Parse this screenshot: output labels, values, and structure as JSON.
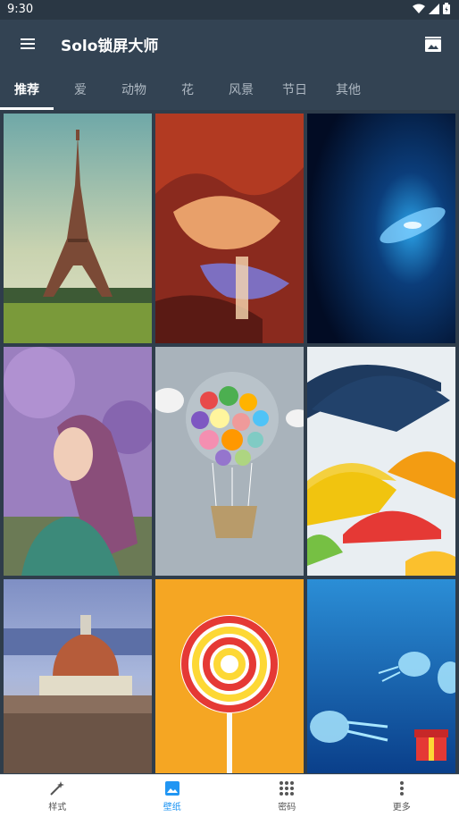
{
  "status": {
    "time": "9:30"
  },
  "app": {
    "title": "Solo锁屏大师"
  },
  "tabs": [
    {
      "label": "推荐",
      "active": true
    },
    {
      "label": "爱"
    },
    {
      "label": "动物"
    },
    {
      "label": "花"
    },
    {
      "label": "风景"
    },
    {
      "label": "节日"
    },
    {
      "label": "其他"
    }
  ],
  "wallpapers": [
    {
      "name": "eiffel-tower"
    },
    {
      "name": "antelope-canyon"
    },
    {
      "name": "blue-galaxy"
    },
    {
      "name": "girl-purple"
    },
    {
      "name": "button-balloon"
    },
    {
      "name": "umbrellas"
    },
    {
      "name": "florence-cathedral"
    },
    {
      "name": "lollipop"
    },
    {
      "name": "jellyfish"
    }
  ],
  "bottom_nav": [
    {
      "label": "样式",
      "icon": "magic-wand-icon"
    },
    {
      "label": "壁纸",
      "icon": "wallpaper-icon",
      "active": true
    },
    {
      "label": "密码",
      "icon": "pattern-lock-icon"
    },
    {
      "label": "更多",
      "icon": "more-vertical-icon"
    }
  ],
  "colors": {
    "appbar": "#334353",
    "accent": "#2196f3",
    "background": "#2f3d4b"
  }
}
